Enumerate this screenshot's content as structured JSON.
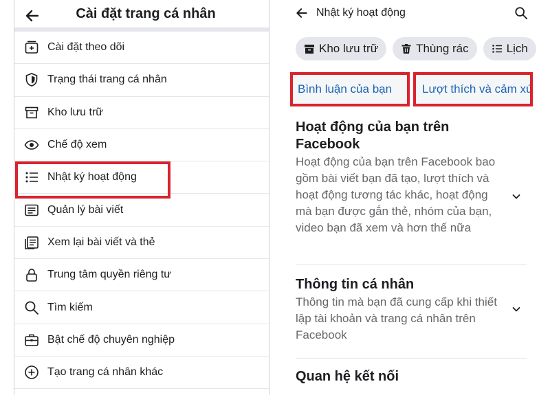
{
  "left": {
    "title": "Cài đặt trang cá nhân",
    "items": [
      {
        "label": "Cài đặt theo dõi",
        "icon": "follow-settings-icon"
      },
      {
        "label": "Trạng thái trang cá nhân",
        "icon": "shield-icon"
      },
      {
        "label": "Kho lưu trữ",
        "icon": "archive-icon"
      },
      {
        "label": "Chế độ xem",
        "icon": "eye-icon"
      },
      {
        "label": "Nhật ký hoạt động",
        "icon": "list-icon"
      },
      {
        "label": "Quản lý bài viết",
        "icon": "manage-posts-icon"
      },
      {
        "label": "Xem lại bài viết và thẻ",
        "icon": "review-posts-icon"
      },
      {
        "label": "Trung tâm quyền riêng tư",
        "icon": "lock-icon"
      },
      {
        "label": "Tìm kiếm",
        "icon": "search-icon"
      },
      {
        "label": "Bật chế độ chuyên nghiệp",
        "icon": "briefcase-icon"
      },
      {
        "label": "Tạo trang cá nhân khác",
        "icon": "add-circle-icon"
      }
    ]
  },
  "right": {
    "title": "Nhật ký hoạt động",
    "chips": [
      {
        "label": "Kho lưu trữ",
        "icon": "archive-icon"
      },
      {
        "label": "Thùng rác",
        "icon": "trash-icon"
      },
      {
        "label": "Lịch",
        "icon": "list-icon"
      }
    ],
    "tabs": [
      {
        "label": "Bình luận của bạn"
      },
      {
        "label": "Lượt thích và cảm xúc"
      }
    ],
    "sections": [
      {
        "title": "Hoạt động của bạn trên Facebook",
        "desc": "Hoạt động của bạn trên Facebook bao gồm bài viết bạn đã tạo, lượt thích và hoạt động tương tác khác, hoạt động mà bạn được gắn thẻ, nhóm của bạn, video bạn đã xem và hơn thế nữa"
      },
      {
        "title": "Thông tin cá nhân",
        "desc": "Thông tin mà bạn đã cung cấp khi thiết lập tài khoản và trang cá nhân trên Facebook"
      },
      {
        "title": "Quan hệ kết nối",
        "desc": ""
      }
    ]
  },
  "colors": {
    "highlight": "#d9232e",
    "link": "#1a63b5",
    "chip_bg": "#e4e6eb"
  }
}
